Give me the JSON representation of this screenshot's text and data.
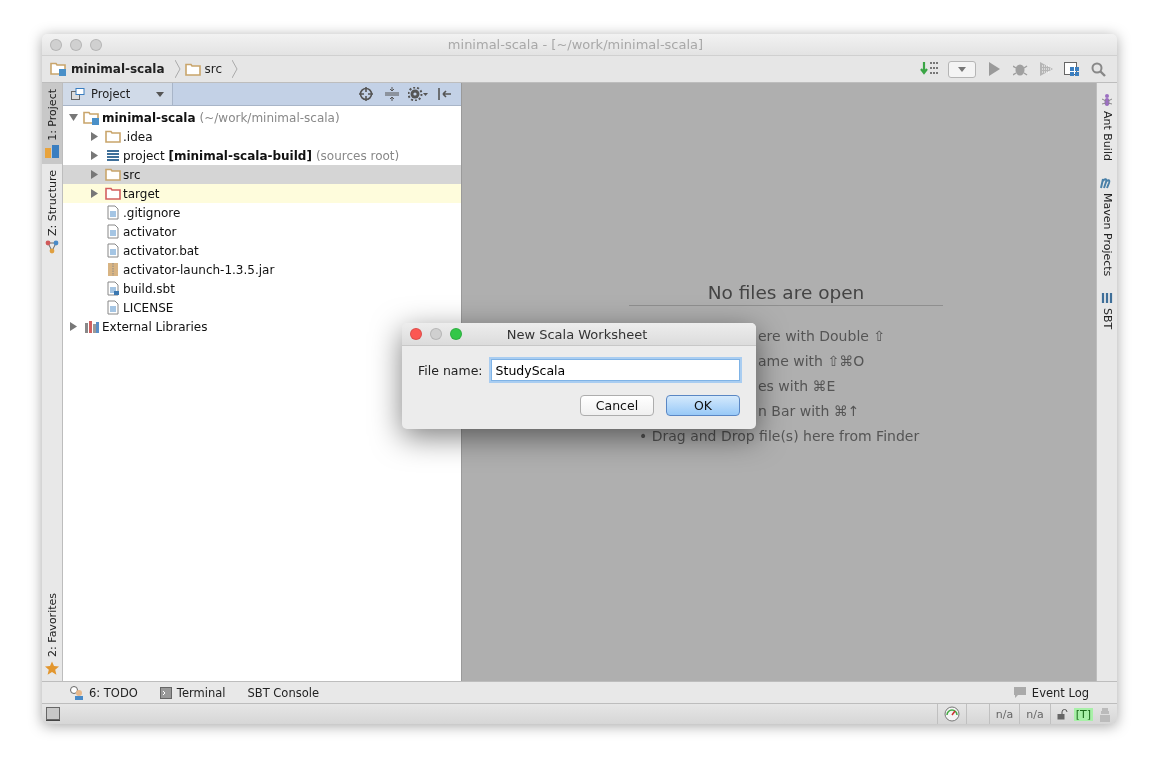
{
  "window": {
    "title": "minimal-scala - [~/work/minimal-scala]"
  },
  "breadcrumbs": [
    {
      "label": "minimal-scala",
      "kind": "module"
    },
    {
      "label": "src",
      "kind": "folder"
    }
  ],
  "left_stripe": {
    "top": [
      {
        "label": "1: Project",
        "kind": "project",
        "selected": true
      },
      {
        "label": "Z: Structure",
        "kind": "structure",
        "selected": false
      }
    ],
    "bottom": [
      {
        "label": "2: Favorites",
        "kind": "favorites",
        "selected": false
      }
    ]
  },
  "project_panel": {
    "view": "Project",
    "tree": [
      {
        "label": "minimal-scala",
        "note": "(~/work/minimal-scala)",
        "kind": "module",
        "expanded": true,
        "selected": false,
        "highlighted": false,
        "children": [
          {
            "label": ".idea",
            "kind": "folder",
            "expanded": false,
            "selected": false,
            "highlighted": false
          },
          {
            "label": "project **[minimal-scala-build]**",
            "note": "(sources root)",
            "kind": "source-root",
            "expanded": false,
            "selected": false,
            "highlighted": false
          },
          {
            "label": "src",
            "kind": "folder",
            "expanded": false,
            "selected": true,
            "highlighted": false
          },
          {
            "label": "target",
            "kind": "excluded-folder",
            "expanded": false,
            "selected": false,
            "highlighted": true
          },
          {
            "label": ".gitignore",
            "kind": "file",
            "selected": false,
            "highlighted": false
          },
          {
            "label": "activator",
            "kind": "file",
            "selected": false,
            "highlighted": false
          },
          {
            "label": "activator.bat",
            "kind": "file",
            "selected": false,
            "highlighted": false
          },
          {
            "label": "activator-launch-1.3.5.jar",
            "kind": "jar",
            "selected": false,
            "highlighted": false
          },
          {
            "label": "build.sbt",
            "kind": "sbt",
            "selected": false,
            "highlighted": false
          },
          {
            "label": "LICENSE",
            "kind": "file",
            "selected": false,
            "highlighted": false
          }
        ]
      },
      {
        "label": "External Libraries",
        "kind": "libraries",
        "expanded": false,
        "selected": false,
        "highlighted": false
      }
    ]
  },
  "editor": {
    "heading": "No files are open",
    "hints": [
      {
        "text": "ere with Double ⇧",
        "kind": "partial"
      },
      {
        "text": "ame with ⇧⌘O",
        "kind": "partial"
      },
      {
        "text": "es with ⌘E",
        "kind": "partial"
      },
      {
        "text": "n Bar with ⌘↑",
        "kind": "partial"
      },
      {
        "text": "• Drag and Drop file(s) here from Finder",
        "kind": "full"
      }
    ]
  },
  "right_stripe": [
    {
      "label": "Ant Build",
      "kind": "ant"
    },
    {
      "label": "Maven Projects",
      "kind": "maven"
    },
    {
      "label": "SBT",
      "kind": "sbt"
    }
  ],
  "dialog": {
    "title": "New Scala Worksheet",
    "field_label": "File name:",
    "value": "StudyScala",
    "buttons": [
      {
        "label": "Cancel",
        "default": false
      },
      {
        "label": "OK",
        "default": true
      }
    ]
  },
  "tool_windows": [
    {
      "label": "6: TODO",
      "kind": "todo"
    },
    {
      "label": "Terminal",
      "kind": "terminal"
    },
    {
      "label": "SBT Console",
      "kind": "none"
    }
  ],
  "event_log": "Event Log",
  "status_bar": {
    "fields": [
      {
        "text": "n/a"
      },
      {
        "text": "n/a"
      }
    ],
    "inspection": "[T]"
  }
}
